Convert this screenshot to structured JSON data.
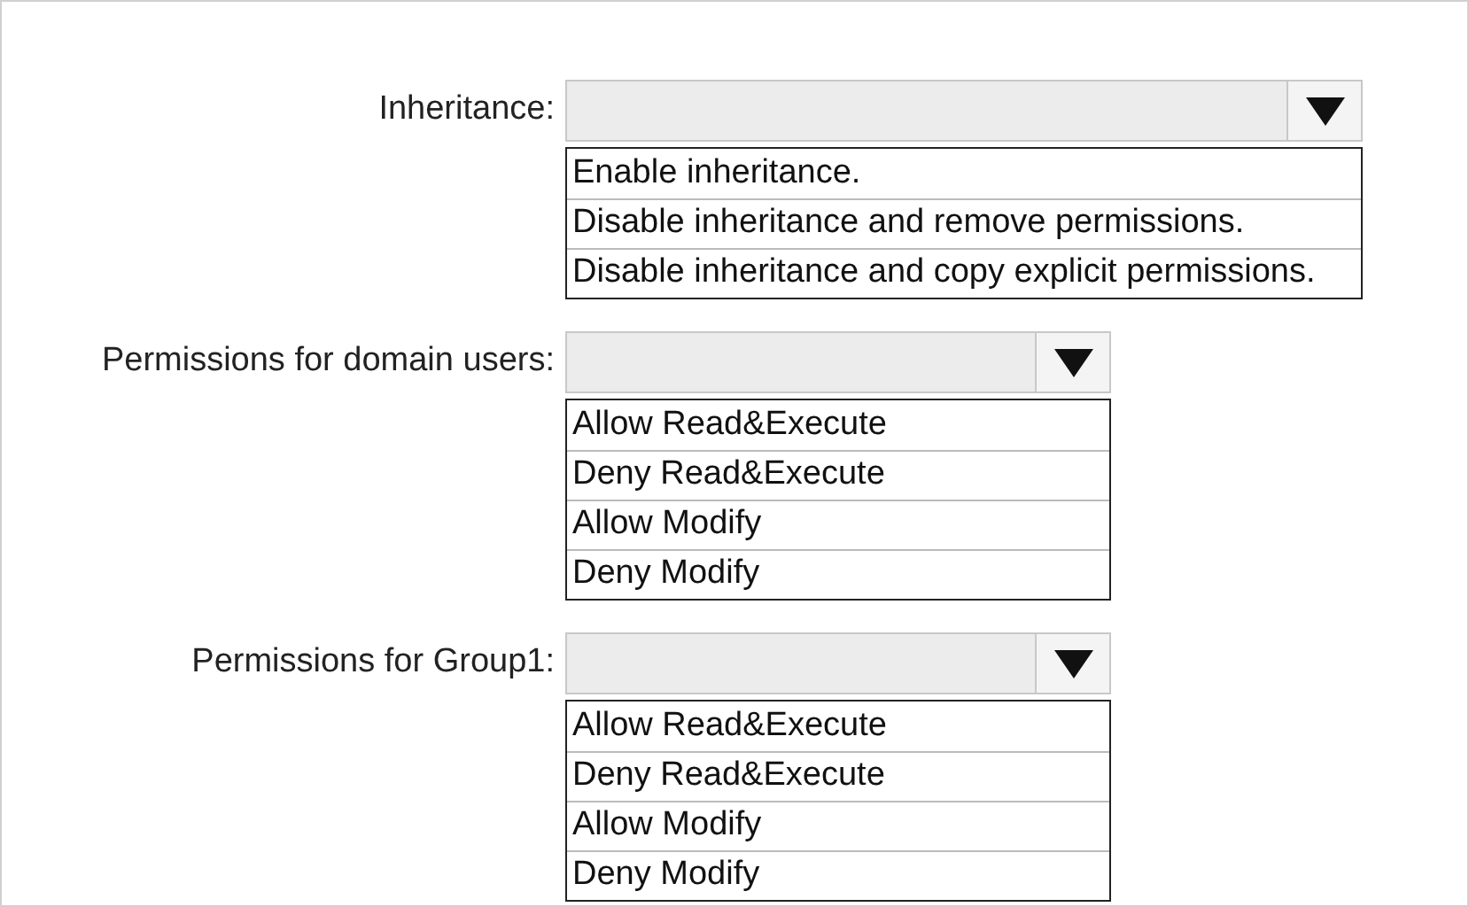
{
  "sections": [
    {
      "label": "Inheritance:",
      "options": [
        "Enable inheritance.",
        "Disable inheritance and remove permissions.",
        "Disable inheritance and copy explicit permissions."
      ]
    },
    {
      "label": "Permissions for domain users:",
      "options": [
        "Allow Read&Execute",
        "Deny Read&Execute",
        "Allow Modify",
        "Deny Modify"
      ]
    },
    {
      "label": "Permissions for Group1:",
      "options": [
        "Allow Read&Execute",
        "Deny Read&Execute",
        "Allow Modify",
        "Deny Modify"
      ]
    }
  ]
}
